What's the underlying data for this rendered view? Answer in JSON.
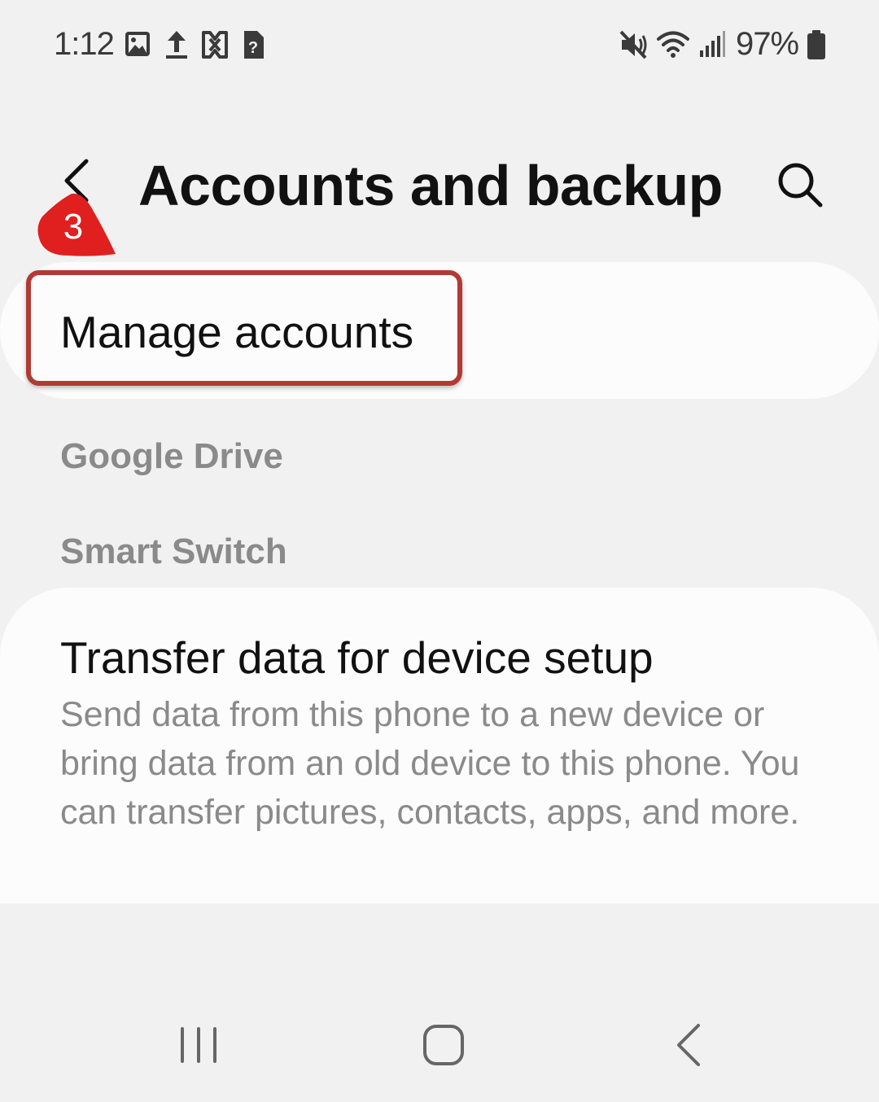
{
  "status_bar": {
    "time": "1:12",
    "battery_percent": "97%",
    "left_icons": [
      "gallery-icon",
      "upload-icon",
      "link-app-icon",
      "unknown-app-icon"
    ],
    "right_icons": [
      "mute-icon",
      "wifi-icon",
      "signal-icon",
      "battery-icon"
    ]
  },
  "header": {
    "title": "Accounts and backup",
    "back_icon": "back-arrow-icon",
    "search_icon": "search-icon"
  },
  "annotation": {
    "step_number": "3",
    "badge_color": "#e01f1f",
    "highlight_color": "#b23a34"
  },
  "items": {
    "manage_accounts": "Manage accounts",
    "google_drive_header": "Google Drive",
    "smart_switch_header": "Smart Switch",
    "transfer_title": "Transfer data for device setup",
    "transfer_desc": "Send data from this phone to a new device or bring data from an old device to this phone. You can transfer pictures, contacts, apps, and more."
  },
  "nav_bar": {
    "recents_icon": "recents-icon",
    "home_icon": "home-icon",
    "back_icon": "nav-back-icon"
  }
}
